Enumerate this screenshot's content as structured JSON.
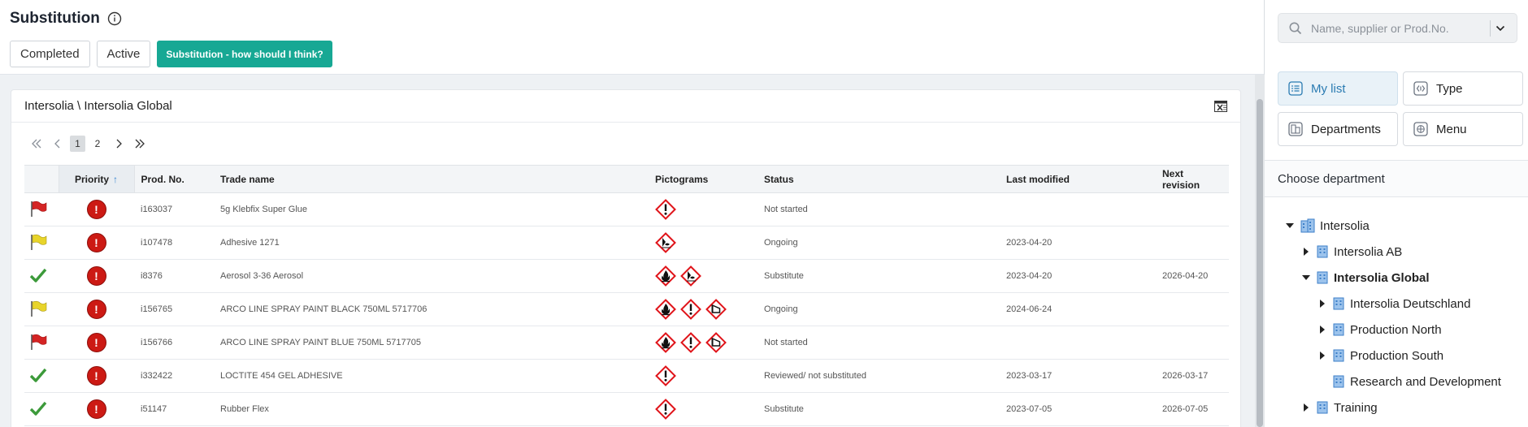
{
  "header": {
    "title": "Substitution",
    "buttons": {
      "completed": "Completed",
      "active": "Active",
      "help": "Substitution - how should I think?"
    }
  },
  "card": {
    "title": "Intersolia \\ Intersolia Global",
    "pagination": {
      "pages": [
        "1",
        "2"
      ],
      "current": "1"
    }
  },
  "table": {
    "headers": {
      "priority": "Priority",
      "prod_no": "Prod. No.",
      "trade_name": "Trade name",
      "pictograms": "Pictograms",
      "status": "Status",
      "last_modified": "Last modified",
      "next_revision": "Next revision"
    },
    "rows": [
      {
        "flag": "red-flag",
        "priority": "!",
        "prod_no": "i163037",
        "trade_name": "5g Klebfix Super Glue",
        "pictograms": [
          "ghs07-exclamation"
        ],
        "status": "Not started",
        "last_modified": "",
        "next_revision": ""
      },
      {
        "flag": "yellow-flag",
        "priority": "!",
        "prod_no": "i107478",
        "trade_name": "Adhesive 1271",
        "pictograms": [
          "ghs09-environment"
        ],
        "status": "Ongoing",
        "last_modified": "2023-04-20",
        "next_revision": ""
      },
      {
        "flag": "green-check",
        "priority": "!",
        "prod_no": "i8376",
        "trade_name": "Aerosol 3-36 Aerosol",
        "pictograms": [
          "ghs02-flame",
          "ghs09-environment"
        ],
        "status": "Substitute",
        "last_modified": "2023-04-20",
        "next_revision": "2026-04-20"
      },
      {
        "flag": "yellow-flag",
        "priority": "!",
        "prod_no": "i156765",
        "trade_name": "ARCO LINE SPRAY PAINT BLACK 750ML 5717706",
        "pictograms": [
          "ghs02-flame",
          "ghs07-exclamation",
          "ghs04-gas"
        ],
        "status": "Ongoing",
        "last_modified": "2024-06-24",
        "next_revision": ""
      },
      {
        "flag": "red-flag",
        "priority": "!",
        "prod_no": "i156766",
        "trade_name": "ARCO LINE SPRAY PAINT BLUE 750ML 5717705",
        "pictograms": [
          "ghs02-flame",
          "ghs07-exclamation",
          "ghs04-gas"
        ],
        "status": "Not started",
        "last_modified": "",
        "next_revision": ""
      },
      {
        "flag": "green-check",
        "priority": "!",
        "prod_no": "i332422",
        "trade_name": "LOCTITE 454 GEL ADHESIVE",
        "pictograms": [
          "ghs07-exclamation"
        ],
        "status": "Reviewed/ not substituted",
        "last_modified": "2023-03-17",
        "next_revision": "2026-03-17"
      },
      {
        "flag": "green-check",
        "priority": "!",
        "prod_no": "i51147",
        "trade_name": "Rubber Flex",
        "pictograms": [
          "ghs07-exclamation"
        ],
        "status": "Substitute",
        "last_modified": "2023-07-05",
        "next_revision": "2026-07-05"
      }
    ]
  },
  "side": {
    "search": {
      "placeholder": "Name, supplier or Prod.No."
    },
    "tiles": {
      "my_list": "My list",
      "type": "Type",
      "departments": "Departments",
      "menu": "Menu"
    },
    "choose_department": "Choose department",
    "tree": {
      "root": "Intersolia",
      "ab": "Intersolia AB",
      "global": "Intersolia Global",
      "deutschland": "Intersolia Deutschland",
      "north": "Production North",
      "south": "Production South",
      "rnd": "Research and Development",
      "training": "Training"
    }
  },
  "colors": {
    "accent_teal": "#17a894",
    "priority_red": "#cc1a14",
    "link_blue": "#2a7bb2"
  }
}
